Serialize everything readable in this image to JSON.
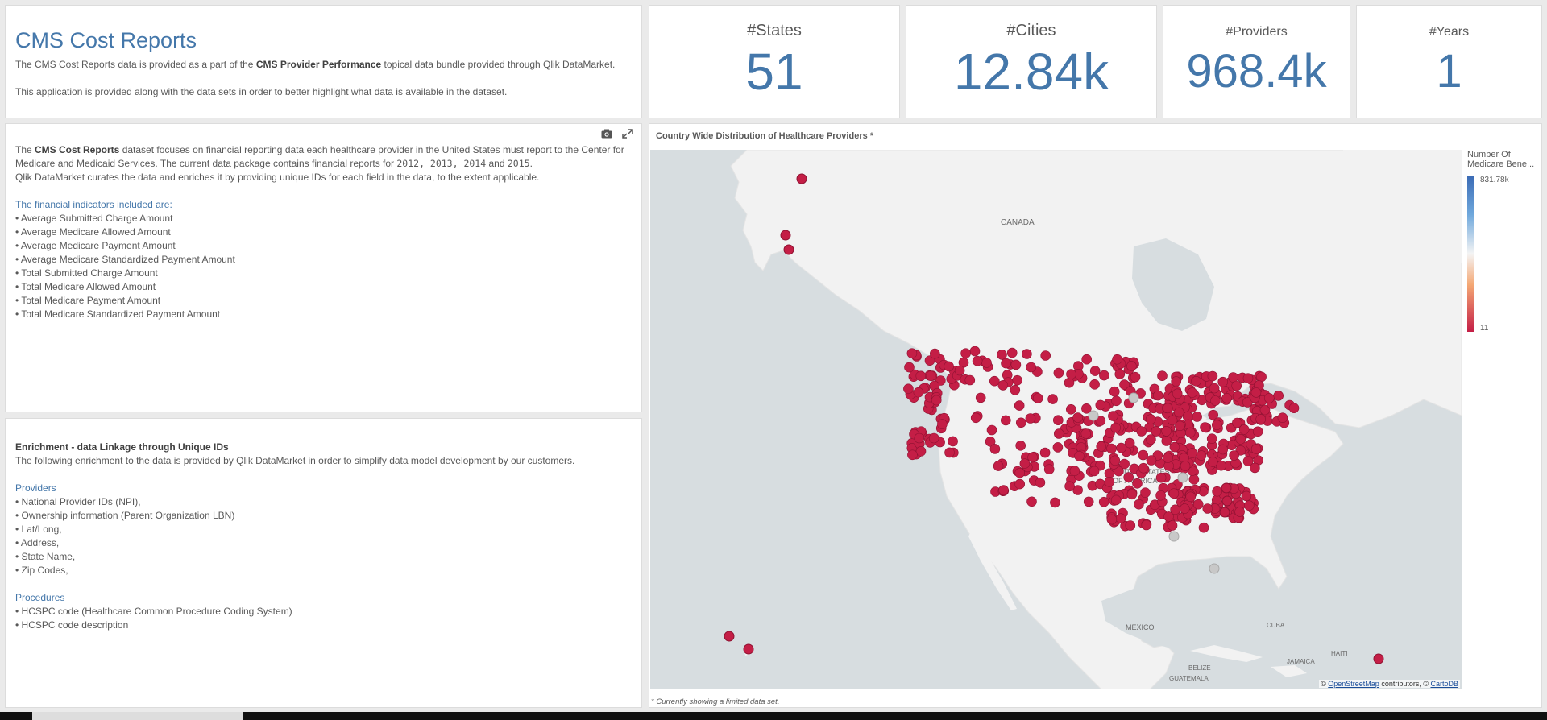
{
  "header": {
    "title": "CMS Cost Reports",
    "desc1_pre": "The CMS Cost Reports data is provided as a part of the ",
    "desc1_bold": "CMS Provider Performance",
    "desc1_post": " topical data bundle provided through Qlik DataMarket.",
    "desc2": "This application is provided along with the data sets in order to better highlight what data is available in the dataset."
  },
  "kpis": [
    {
      "title": "#States",
      "value": "51"
    },
    {
      "title": "#Cities",
      "value": "12.84k"
    },
    {
      "title": "#Providers",
      "value": "968.4k"
    },
    {
      "title": "#Years",
      "value": "1"
    }
  ],
  "info": {
    "p1_pre": "The ",
    "p1_bold": "CMS Cost Reports",
    "p1_post": " dataset focuses on financial reporting data each healthcare provider in the United States must report to the Center for Medicare and Medicaid Services. The current data package contains financial reports for ",
    "years": "2012, 2013, 2014",
    "and": " and ",
    "year_last": "2015",
    "period": ".",
    "p2": "Qlik DataMarket curates the data and enriches it by providing unique IDs for each field in the data, to the extent applicable.",
    "indicators_heading": "The financial indicators included are:",
    "indicators": [
      "Average Submitted Charge Amount",
      "Average Medicare Allowed Amount",
      "Average Medicare Payment Amount",
      "Average Medicare Standardized Payment Amount",
      "Total Submitted Charge Amount",
      "Total Medicare Allowed Amount",
      "Total Medicare Payment Amount",
      "Total Medicare Standardized Payment Amount"
    ]
  },
  "enrichment": {
    "heading": "Enrichment - data Linkage through Unique IDs",
    "desc": "The following enrichment to the data is provided by Qlik DataMarket in order to simplify data model development by our customers.",
    "providers_heading": "Providers",
    "providers": [
      "National Provider IDs (NPI),",
      "Ownership information (Parent Organization LBN)",
      "Lat/Long,",
      "Address,",
      "State Name,",
      "Zip Codes,"
    ],
    "procedures_heading": "Procedures",
    "procedures": [
      "HCSPC code (Healthcare Common Procedure Coding System)",
      "HCSPC code description"
    ]
  },
  "map": {
    "title": "Country Wide Distribution of Healthcare Providers *",
    "footnote": "* Currently showing a limited data set.",
    "legend_title_1": "Number Of",
    "legend_title_2": "Medicare Bene...",
    "legend_max": "831.78k",
    "legend_min": "11",
    "attribution_pre": "© ",
    "attribution_osm": "OpenStreetMap",
    "attribution_mid": " contributors, © ",
    "attribution_carto": "CartoDB",
    "labels": {
      "canada": "CANADA",
      "us1": "UNITED STATES",
      "us2": "OF AMERICA",
      "mexico": "MEXICO",
      "cuba": "CUBA",
      "haiti": "HAITI",
      "jamaica": "JAMAICA",
      "belize": "BELIZE",
      "guatemala": "GUATEMALA"
    },
    "colors": {
      "point": "#c41e46",
      "point_stroke": "#8e1232",
      "grey_point": "#c8c8c8",
      "land": "#f2f2f2",
      "water": "#d7dde0"
    }
  }
}
